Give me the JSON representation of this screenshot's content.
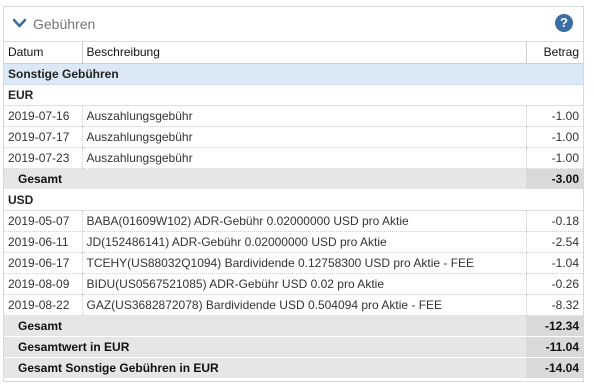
{
  "panel": {
    "title": "Gebühren",
    "help_icon": "?"
  },
  "table": {
    "columns": {
      "date": "Datum",
      "description": "Beschreibung",
      "amount": "Betrag"
    },
    "section_title": "Sonstige Gebühren",
    "groups": [
      {
        "currency": "EUR",
        "rows": [
          {
            "date": "2019-07-16",
            "description": "Auszahlungsgebühr",
            "amount": "-1.00"
          },
          {
            "date": "2019-07-17",
            "description": "Auszahlungsgebühr",
            "amount": "-1.00"
          },
          {
            "date": "2019-07-23",
            "description": "Auszahlungsgebühr",
            "amount": "-1.00"
          }
        ],
        "total_label": "Gesamt",
        "total": "-3.00"
      },
      {
        "currency": "USD",
        "rows": [
          {
            "date": "2019-05-07",
            "description": "BABA(01609W102) ADR-Gebühr 0.02000000 USD pro Aktie",
            "amount": "-0.18"
          },
          {
            "date": "2019-06-11",
            "description": "JD(152486141) ADR-Gebühr 0.02000000 USD pro Aktie",
            "amount": "-2.54"
          },
          {
            "date": "2019-06-17",
            "description": "TCEHY(US88032Q1094) Bardividende 0.12758300 USD pro Aktie - FEE",
            "amount": "-1.04"
          },
          {
            "date": "2019-08-09",
            "description": "BIDU(US0567521085) ADR-Gebühr USD 0.02 pro Aktie",
            "amount": "-0.26"
          },
          {
            "date": "2019-08-22",
            "description": "GAZ(US3682872078) Bardividende USD 0.504094 pro Aktie - FEE",
            "amount": "-8.32"
          }
        ],
        "total_label": "Gesamt",
        "total": "-12.34",
        "converted_label": "Gesamtwert in EUR",
        "converted_total": "-11.04"
      }
    ],
    "grand_total_label": "Gesamt Sonstige Gebühren in EUR",
    "grand_total": "-14.04"
  }
}
